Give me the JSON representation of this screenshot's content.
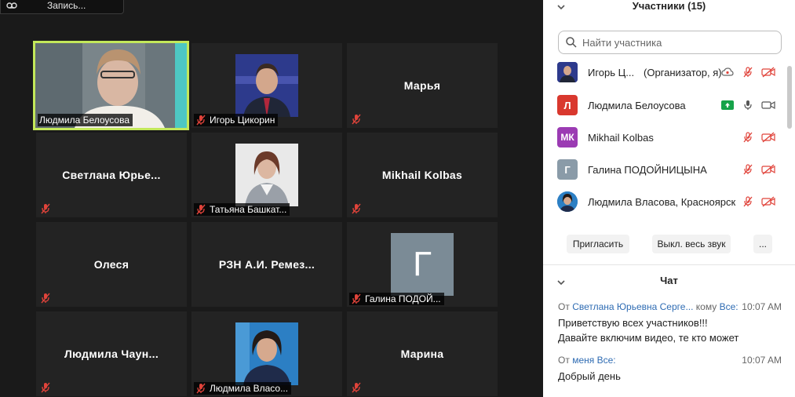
{
  "recording": {
    "label": "Запись..."
  },
  "tiles": [
    {
      "name": "Людмила Белоусова"
    },
    {
      "name": "Игорь Цикорин"
    },
    {
      "name": "Марья"
    },
    {
      "name": "Светлана Юрье..."
    },
    {
      "name": "Татьяна Башкат..."
    },
    {
      "name": "Mikhail Kolbas"
    },
    {
      "name": "Олеся"
    },
    {
      "name": "РЗН А.И. Ремез..."
    },
    {
      "name": "Галина ПОДОЙ...",
      "avatar_letter": "Г"
    },
    {
      "name": "Людмила Чаун..."
    },
    {
      "name": "Людмила Власо..."
    },
    {
      "name": "Марина"
    }
  ],
  "participants_panel": {
    "title": "Участники (15)",
    "search_placeholder": "Найти участника",
    "rows": [
      {
        "name": "Игорь Ц...",
        "role": "(Организатор, я)"
      },
      {
        "name": "Людмила Белоусова",
        "initials": "Л",
        "avatar_color": "#d9382e"
      },
      {
        "name": "Mikhail Kolbas",
        "initials": "МК",
        "avatar_color": "#9b3bb3"
      },
      {
        "name": "Галина ПОДОЙНИЦЫНА",
        "initials": "Г",
        "avatar_color": "#8a9ba8"
      },
      {
        "name": "Людмила Власова, Красноярск"
      }
    ],
    "invite_label": "Пригласить",
    "mute_all_label": "Выкл. весь звук",
    "more_label": "..."
  },
  "chat": {
    "title": "Чат",
    "messages": [
      {
        "from_prefix": "От",
        "from": "Светлана Юрьевна Серге...",
        "to_prefix": "кому",
        "to": "Все:",
        "time": "10:07 AM",
        "lines": [
          "Приветствую всех участников!!!",
          "Давайте включим видео, те кто может"
        ]
      },
      {
        "from_prefix": "От",
        "from": "меня",
        "to": "Все:",
        "time": "10:07 AM",
        "lines": [
          "Добрый день"
        ]
      }
    ]
  },
  "colors": {
    "active_speaker": "#c3e85a",
    "mic_off": "#e0433a",
    "share_green": "#16a34a",
    "link_blue": "#2f6cb3"
  }
}
